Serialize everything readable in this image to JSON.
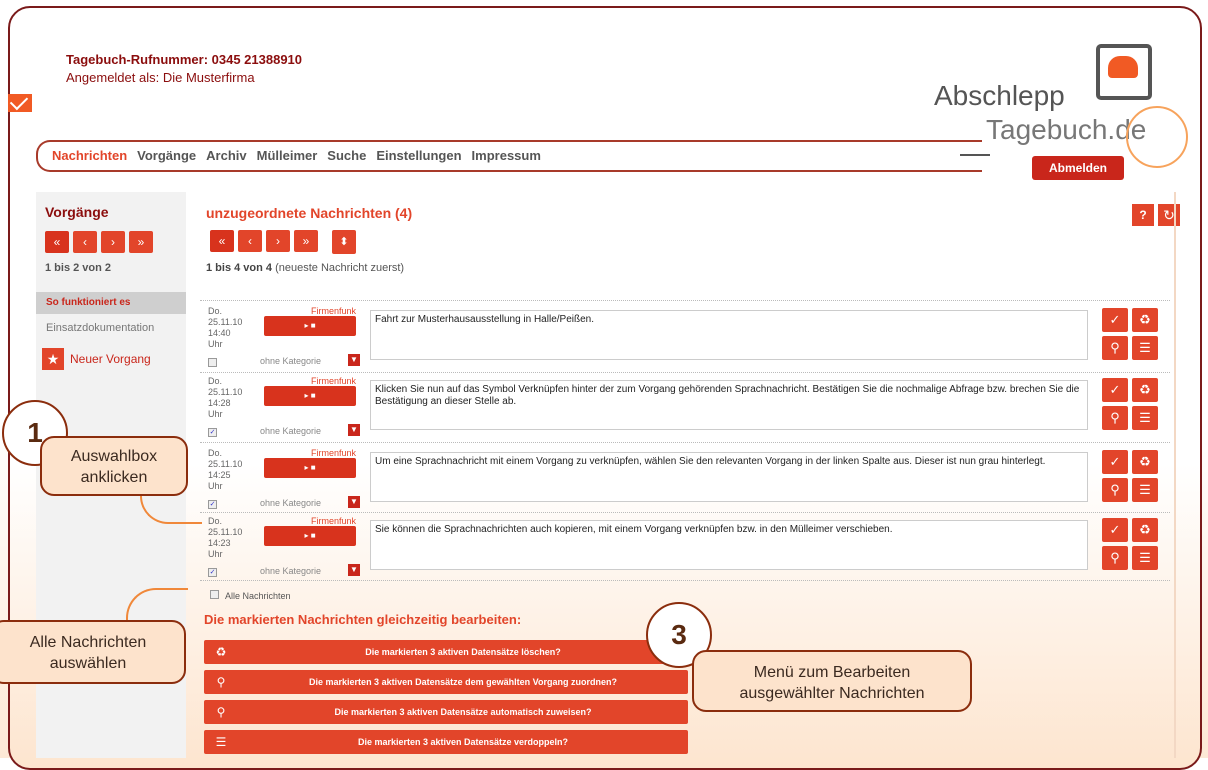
{
  "header": {
    "title": "Tagebuch-Rufnummer: 0345 21388910",
    "logged_in": "Angemeldet als: Die Musterfirma"
  },
  "logo": {
    "line1": "Abschlepp",
    "line2": "Tagebuch.de"
  },
  "nav": {
    "items": [
      "Nachrichten",
      "Vorgänge",
      "Archiv",
      "Mülleimer",
      "Suche",
      "Einstellungen",
      "Impressum"
    ],
    "logout": "Abmelden"
  },
  "left": {
    "title": "Vorgänge",
    "count": "1 bis 2 von 2",
    "howto": "So funktioniert es",
    "entry": "Einsatzdokumentation",
    "new": "Neuer Vorgang"
  },
  "main": {
    "title": "unzugeordnete Nachrichten (4)",
    "count_bold": "1 bis 4 von 4",
    "count_rest": " (neueste Nachricht zuerst)",
    "category_placeholder": "ohne Kategorie",
    "messages": [
      {
        "day": "Do.",
        "date": "25.11.10",
        "time": "14:40",
        "unit": "Uhr",
        "checked": false,
        "source": "Firmenfunk",
        "text": "Fahrt zur Musterhausausstellung in Halle/Peißen."
      },
      {
        "day": "Do.",
        "date": "25.11.10",
        "time": "14:28",
        "unit": "Uhr",
        "checked": true,
        "source": "Firmenfunk",
        "text": "Klicken Sie nun auf das Symbol Verknüpfen hinter der zum Vorgang gehörenden Sprachnachricht. Bestätigen Sie die nochmalige Abfrage bzw. brechen Sie die Bestätigung an dieser Stelle ab."
      },
      {
        "day": "Do.",
        "date": "25.11.10",
        "time": "14:25",
        "unit": "Uhr",
        "checked": true,
        "source": "Firmenfunk",
        "text": "Um eine Sprachnachricht mit einem Vorgang zu verknüpfen, wählen Sie den relevanten Vorgang in der linken Spalte aus. Dieser ist nun grau hinterlegt."
      },
      {
        "day": "Do.",
        "date": "25.11.10",
        "time": "14:23",
        "unit": "Uhr",
        "checked": true,
        "source": "Firmenfunk",
        "text": "Sie können die Sprachnachrichten auch kopieren, mit einem Vorgang verknüpfen bzw. in den Mülleimer verschieben."
      }
    ],
    "select_all": "Alle Nachrichten",
    "bulk_title": "Die markierten Nachrichten gleichzeitig bearbeiten:",
    "bulk_actions": [
      "Die markierten 3 aktiven Datensätze löschen?",
      "Die markierten 3 aktiven Datensätze dem gewählten Vorgang zuordnen?",
      "Die markierten 3 aktiven Datensätze automatisch zuweisen?",
      "Die markierten 3 aktiven Datensätze verdoppeln?"
    ]
  },
  "callouts": {
    "c1_num": "1",
    "c1_text_a": "Auswahlbox",
    "c1_text_b": "anklicken",
    "c2_text_a": "Alle Nachrichten",
    "c2_text_b": "auswählen",
    "c3_num": "3",
    "c3_text_a": "Menü zum Bearbeiten",
    "c3_text_b": "ausgewählter Nachrichten"
  },
  "colors": {
    "accent": "#e2452a",
    "dark_red": "#8b0d0d",
    "callout_bg": "#fde3cc"
  }
}
